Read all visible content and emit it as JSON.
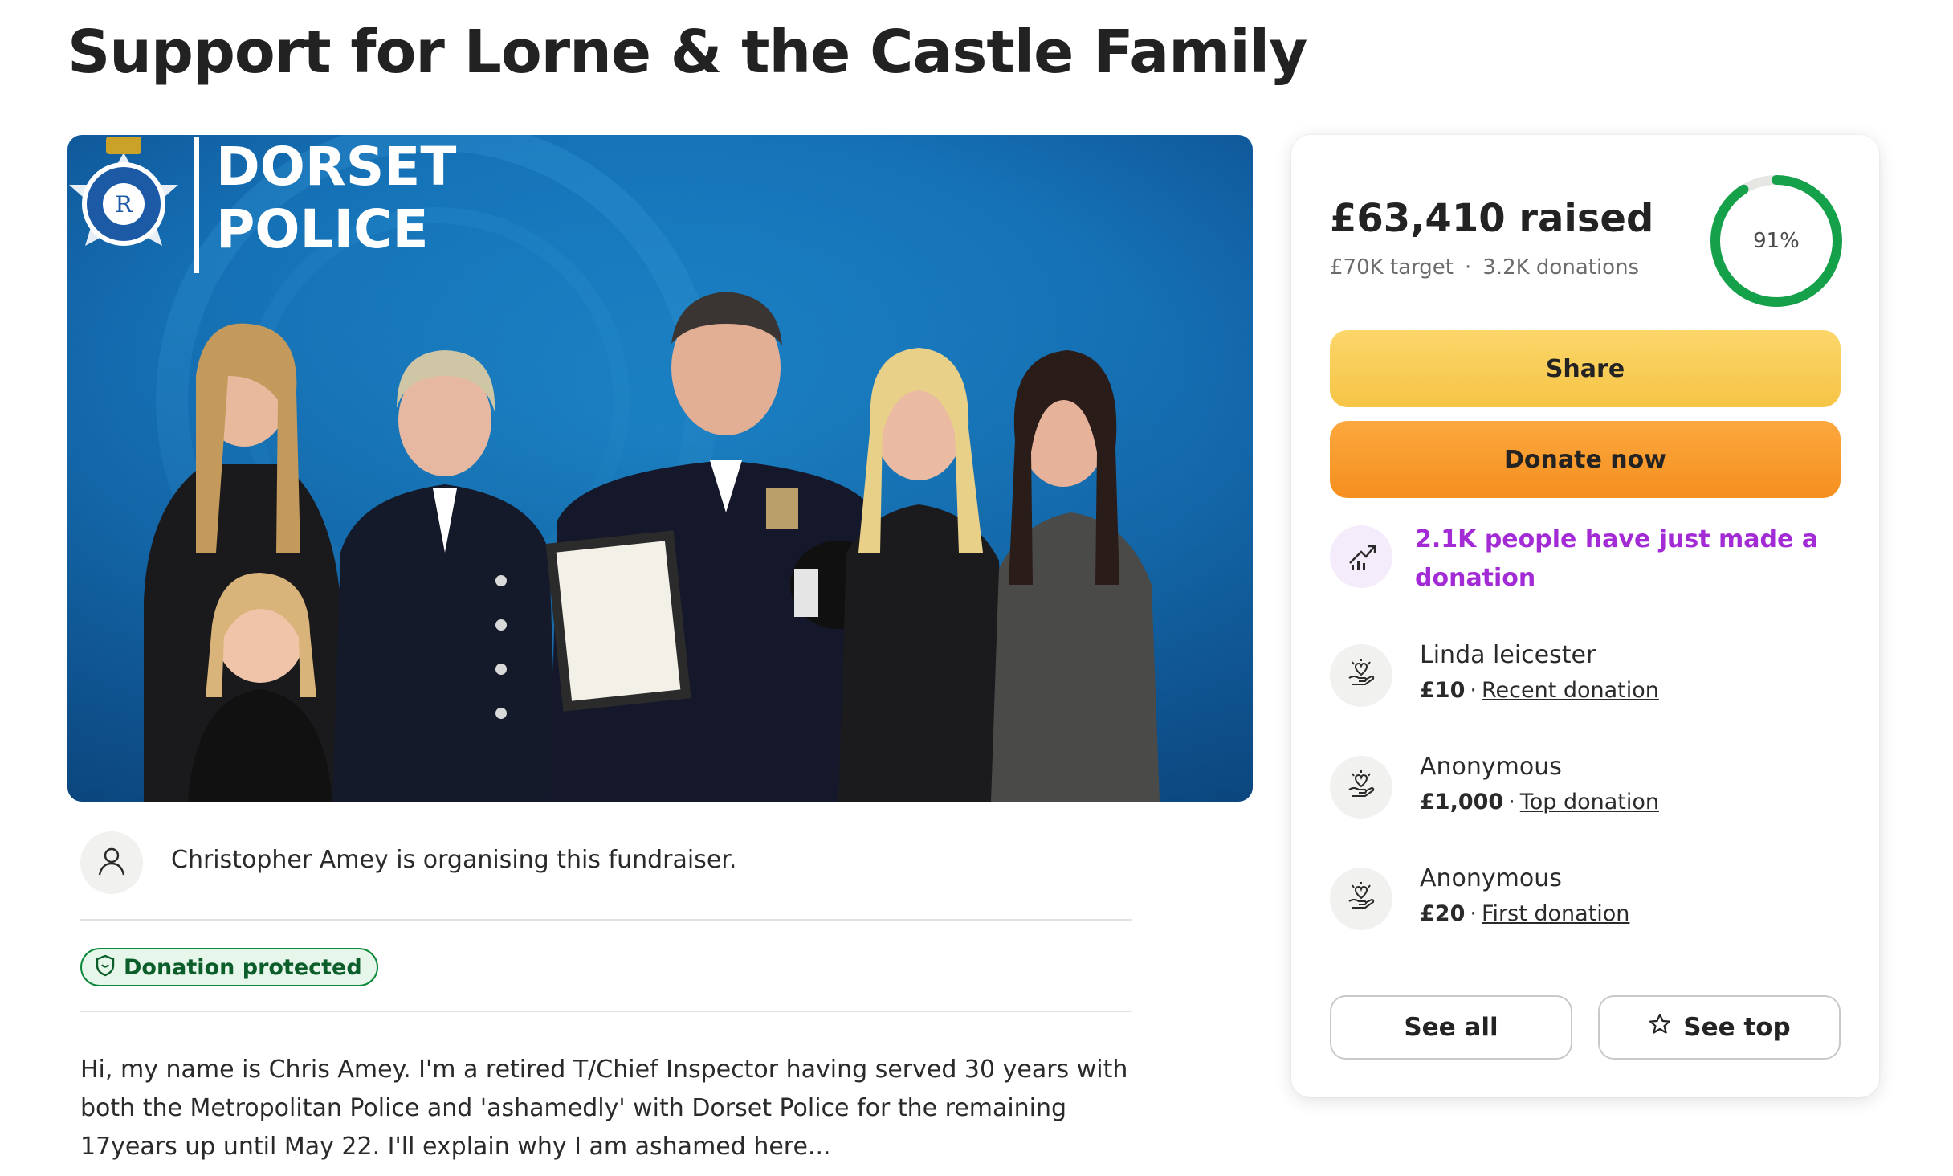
{
  "page": {
    "title": "Support for Lorne & the Castle Family"
  },
  "hero": {
    "banner_line1": "DORSET",
    "banner_line2": "POLICE",
    "badge_top_text": "DORSET",
    "badge_bottom_text": "POLICE"
  },
  "organiser": {
    "text": "Christopher Amey is organising this fundraiser.",
    "icon": "person-icon"
  },
  "protection": {
    "label": "Donation protected",
    "icon": "shield-icon"
  },
  "story": {
    "text": "Hi, my name is Chris Amey. I'm a retired T/Chief Inspector having served 30 years with both the Metropolitan Police and 'ashamedly' with Dorset Police for the remaining 17years up until May 22. I'll explain why I am ashamed here..."
  },
  "progress": {
    "raised": "£63,410 raised",
    "target": "£70K target",
    "separator": "·",
    "donations": "3.2K donations",
    "percent_label": "91%",
    "fraction": 0.91,
    "ring_color": "#15a04a"
  },
  "actions": {
    "share_label": "Share",
    "donate_label": "Donate now"
  },
  "trend": {
    "text": "2.1K people have just made a donation",
    "icon": "trending-up-icon",
    "color": "#a32bd6"
  },
  "donations": [
    {
      "name": "Linda leicester",
      "amount": "£10",
      "sep": "·",
      "tag": "Recent donation",
      "icon": "heart-hand-icon"
    },
    {
      "name": "Anonymous",
      "amount": "£1,000",
      "sep": "·",
      "tag": "Top donation",
      "icon": "heart-hand-icon"
    },
    {
      "name": "Anonymous",
      "amount": "£20",
      "sep": "·",
      "tag": "First donation",
      "icon": "heart-hand-icon"
    }
  ],
  "list_actions": {
    "see_all_label": "See all",
    "see_top_label": "See top",
    "star_icon": "star-icon"
  },
  "colors": {
    "share_button": "#f6c445",
    "donate_button": "#f58f1f",
    "protected_green": "#0b8a3a"
  }
}
